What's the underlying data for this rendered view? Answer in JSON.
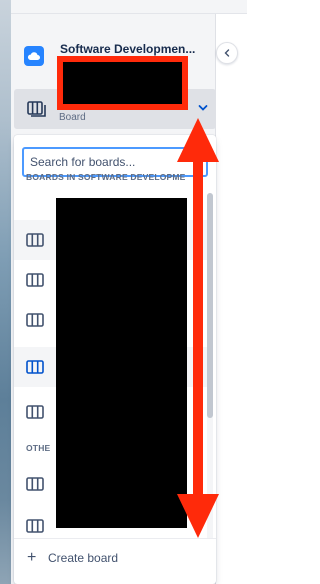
{
  "project": {
    "name": "Software Developmen..."
  },
  "board_switcher": {
    "type_label": "Board"
  },
  "search": {
    "placeholder": "Search for boards..."
  },
  "sections": {
    "software": "BOARDS IN SOFTWARE DEVELOPME",
    "other": "OTHE"
  },
  "create_board": {
    "label": "Create board"
  },
  "colors": {
    "accent": "#2684ff",
    "arrow": "#ff2a0a"
  }
}
